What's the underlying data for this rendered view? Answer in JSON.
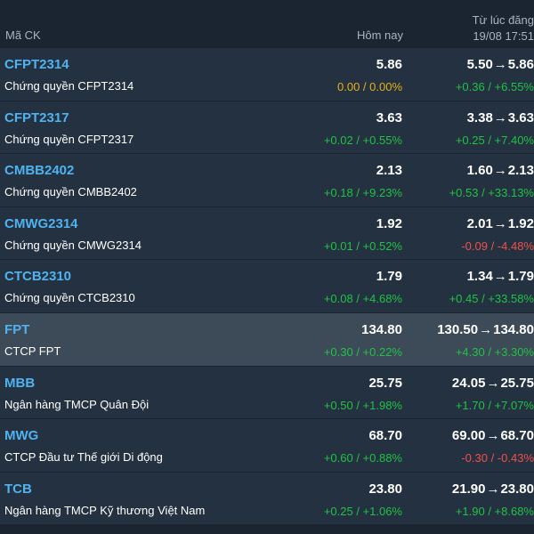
{
  "header": {
    "code_label": "Mã CK",
    "today_label": "Hôm nay",
    "since_label": "Từ lúc đăng",
    "since_time": "19/08 17:51"
  },
  "arrow": "→",
  "rows": [
    {
      "code": "CFPT2314",
      "name": "Chứng quyền CFPT2314",
      "price": "5.86",
      "change": "0.00 / 0.00%",
      "change_dir": "flat",
      "from": "5.50",
      "to": "5.86",
      "since_change": "+0.36 / +6.55%",
      "since_dir": "up",
      "highlight": false
    },
    {
      "code": "CFPT2317",
      "name": "Chứng quyền CFPT2317",
      "price": "3.63",
      "change": "+0.02 / +0.55%",
      "change_dir": "up",
      "from": "3.38",
      "to": "3.63",
      "since_change": "+0.25 / +7.40%",
      "since_dir": "up",
      "highlight": false
    },
    {
      "code": "CMBB2402",
      "name": "Chứng quyền CMBB2402",
      "price": "2.13",
      "change": "+0.18 / +9.23%",
      "change_dir": "up",
      "from": "1.60",
      "to": "2.13",
      "since_change": "+0.53 / +33.13%",
      "since_dir": "up",
      "highlight": false
    },
    {
      "code": "CMWG2314",
      "name": "Chứng quyền CMWG2314",
      "price": "1.92",
      "change": "+0.01 / +0.52%",
      "change_dir": "up",
      "from": "2.01",
      "to": "1.92",
      "since_change": "-0.09 / -4.48%",
      "since_dir": "down",
      "highlight": false
    },
    {
      "code": "CTCB2310",
      "name": "Chứng quyền CTCB2310",
      "price": "1.79",
      "change": "+0.08 / +4.68%",
      "change_dir": "up",
      "from": "1.34",
      "to": "1.79",
      "since_change": "+0.45 / +33.58%",
      "since_dir": "up",
      "highlight": false
    },
    {
      "code": "FPT",
      "name": "CTCP FPT",
      "price": "134.80",
      "change": "+0.30 / +0.22%",
      "change_dir": "up",
      "from": "130.50",
      "to": "134.80",
      "since_change": "+4.30 / +3.30%",
      "since_dir": "up",
      "highlight": true
    },
    {
      "code": "MBB",
      "name": "Ngân hàng TMCP Quân Đội",
      "price": "25.75",
      "change": "+0.50 / +1.98%",
      "change_dir": "up",
      "from": "24.05",
      "to": "25.75",
      "since_change": "+1.70 / +7.07%",
      "since_dir": "up",
      "highlight": false
    },
    {
      "code": "MWG",
      "name": "CTCP Đầu tư Thế giới Di động",
      "price": "68.70",
      "change": "+0.60 / +0.88%",
      "change_dir": "up",
      "from": "69.00",
      "to": "68.70",
      "since_change": "-0.30 / -0.43%",
      "since_dir": "down",
      "highlight": false
    },
    {
      "code": "TCB",
      "name": "Ngân hàng TMCP Kỹ thương Việt Nam",
      "price": "23.80",
      "change": "+0.25 / +1.06%",
      "change_dir": "up",
      "from": "21.90",
      "to": "23.80",
      "since_change": "+1.90 / +8.68%",
      "since_dir": "up",
      "highlight": false
    }
  ],
  "colors": {
    "background": "#1b2531",
    "row_background": "#243140",
    "highlight_background": "#3d4a58",
    "code": "#4fb3ef",
    "up": "#21c245",
    "down": "#f0514b",
    "flat": "#e4b21a"
  }
}
